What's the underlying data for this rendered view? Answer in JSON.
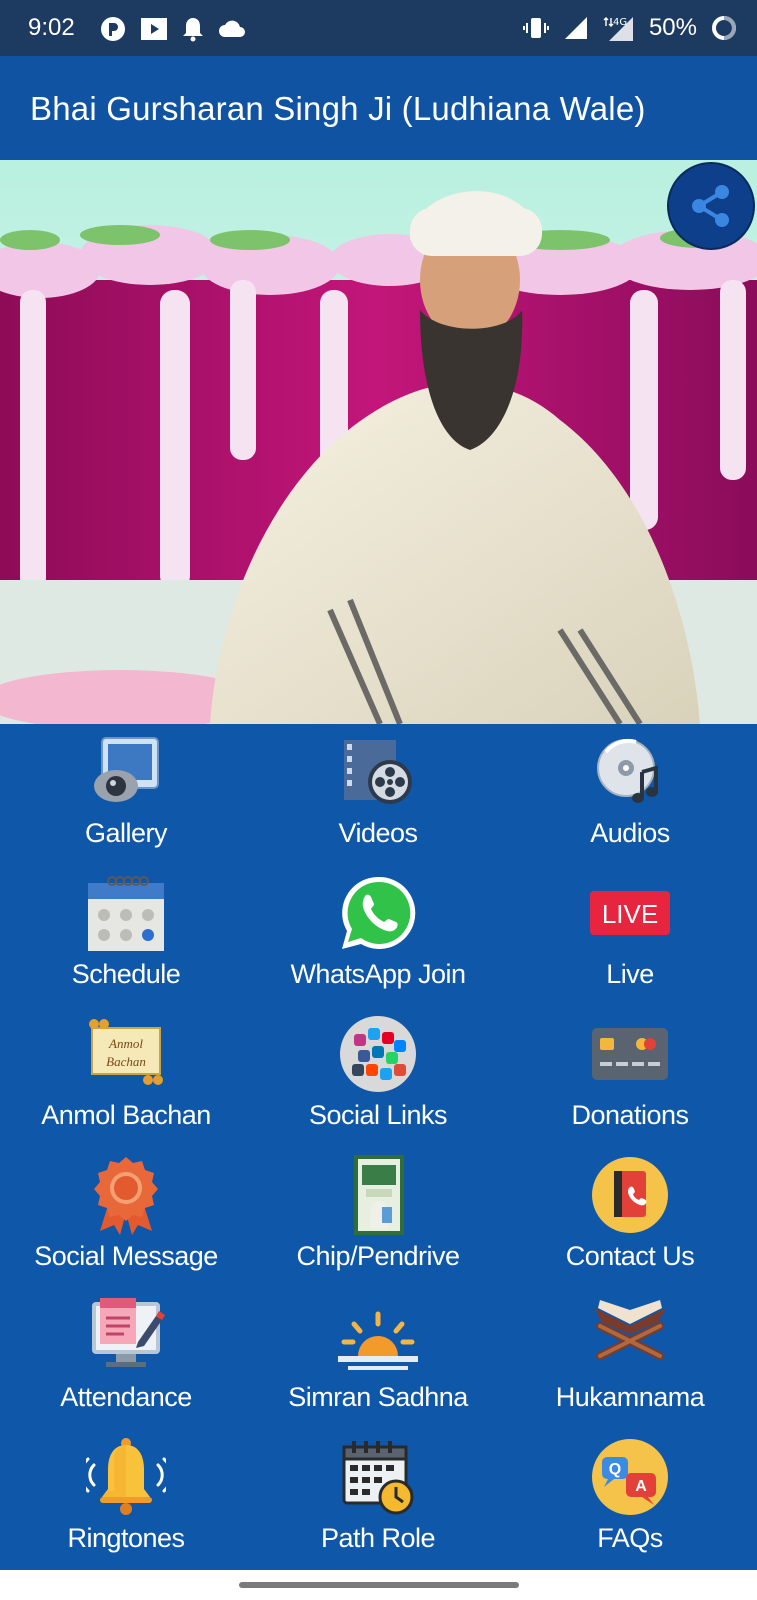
{
  "status_bar": {
    "time": "9:02",
    "battery": "50%",
    "network": "4G"
  },
  "app_bar": {
    "title": "Bhai Gursharan Singh Ji (Ludhiana Wale)"
  },
  "carousel": {
    "slide_count": 4,
    "active_index": 3
  },
  "menu": [
    {
      "label": "Gallery",
      "icon": "gallery-icon"
    },
    {
      "label": "Videos",
      "icon": "film-reel-icon"
    },
    {
      "label": "Audios",
      "icon": "cd-music-icon"
    },
    {
      "label": "Schedule",
      "icon": "calendar-icon"
    },
    {
      "label": "WhatsApp Join",
      "icon": "whatsapp-icon"
    },
    {
      "label": "Live",
      "icon": "live-badge-icon",
      "badge": "LIVE"
    },
    {
      "label": "Anmol Bachan",
      "icon": "quote-card-icon",
      "badge_line1": "Anmol",
      "badge_line2": "Bachan"
    },
    {
      "label": "Social Links",
      "icon": "social-apps-icon"
    },
    {
      "label": "Donations",
      "icon": "credit-card-icon"
    },
    {
      "label": "Social Message",
      "icon": "award-ribbon-icon"
    },
    {
      "label": "Chip/Pendrive",
      "icon": "book-cover-icon"
    },
    {
      "label": "Contact Us",
      "icon": "contact-book-icon"
    },
    {
      "label": "Attendance",
      "icon": "attendance-monitor-icon"
    },
    {
      "label": "Simran Sadhna",
      "icon": "sunrise-icon"
    },
    {
      "label": "Hukamnama",
      "icon": "open-book-stand-icon"
    },
    {
      "label": "Ringtones",
      "icon": "ringing-bell-icon"
    },
    {
      "label": "Path Role",
      "icon": "calendar-clock-icon"
    },
    {
      "label": "FAQs",
      "icon": "qa-bubbles-icon",
      "badge_q": "Q",
      "badge_a": "A"
    }
  ],
  "colors": {
    "status_bar": "#1d3a61",
    "app_bar": "#1153a3",
    "grid_background": "#0f57a8",
    "share_button": "#0d3f8a"
  }
}
